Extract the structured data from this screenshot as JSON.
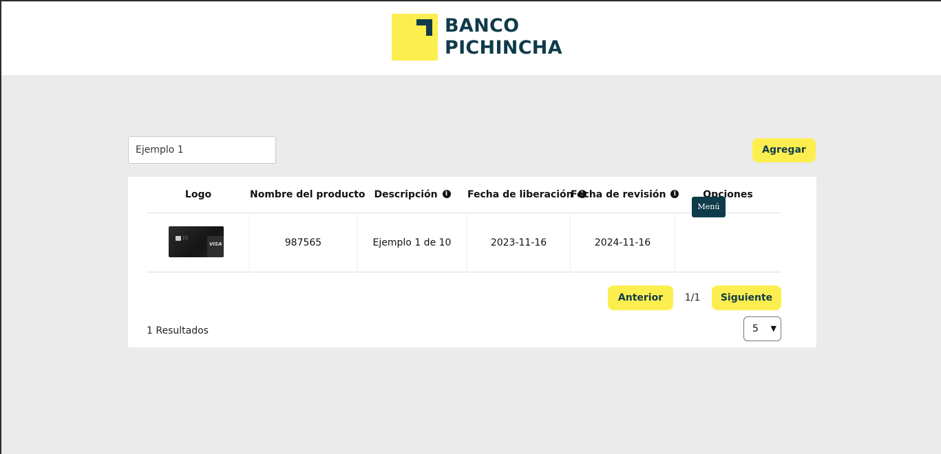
{
  "brand": {
    "line1": "BANCO",
    "line2": "PICHINCHA"
  },
  "search": {
    "value": "Ejemplo 1"
  },
  "toolbar": {
    "add_label": "Agregar"
  },
  "table": {
    "columns": {
      "logo": "Logo",
      "name": "Nombre del producto",
      "description": "Descripción",
      "release_date": "Fecha de liberación",
      "revision_date": "Fecha de revisión",
      "options": "Opciones"
    },
    "info_glyph": "i",
    "rows": [
      {
        "logo_icon": "visa-card-image",
        "card_brand": "VISA",
        "name": "987565",
        "description": "Ejemplo 1 de 10",
        "release_date": "2023-11-16",
        "revision_date": "2024-11-16",
        "menu_label": "Menú"
      }
    ]
  },
  "pagination": {
    "prev_label": "Anterior",
    "page_indicator": "1/1",
    "next_label": "Siguiente",
    "results_text": "1 Resultados",
    "page_size": "5"
  },
  "colors": {
    "brand_yellow": "#fdee4f",
    "brand_navy": "#0f3b4a",
    "page_background": "#ebebeb"
  }
}
